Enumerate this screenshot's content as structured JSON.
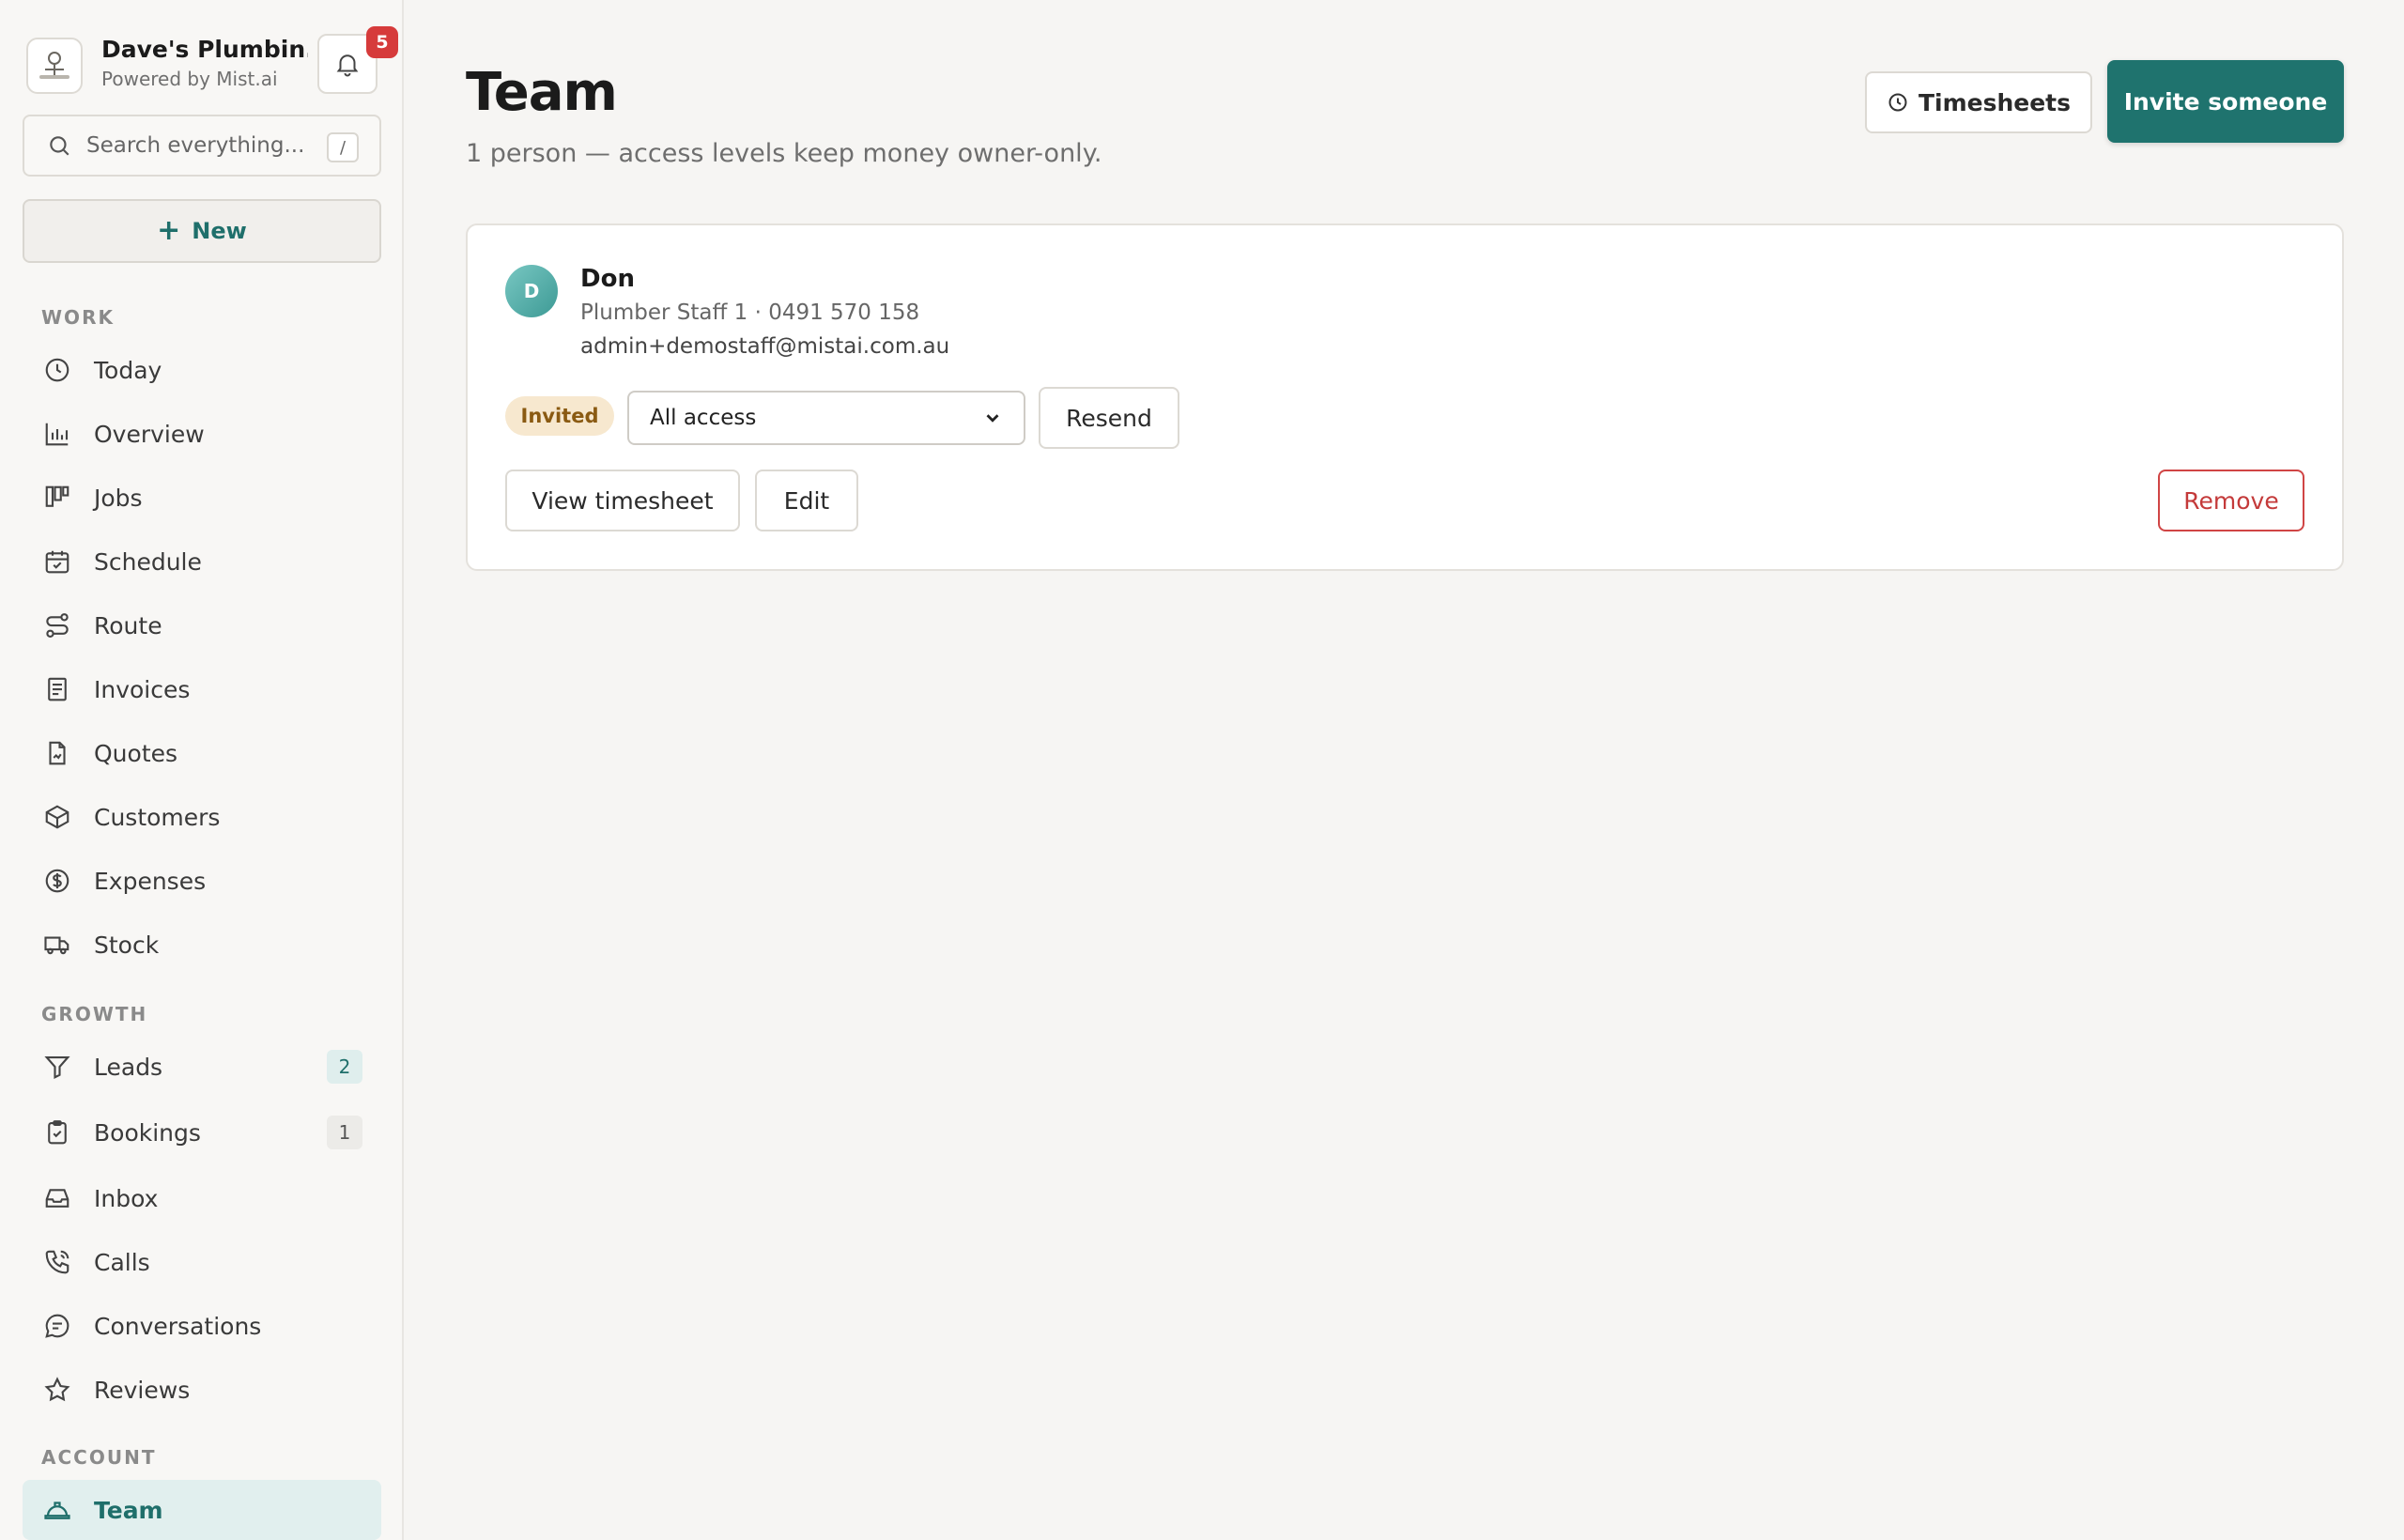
{
  "brand": {
    "name": "Dave's Plumbin...",
    "sub": "Powered by Mist.ai",
    "notifications": "5"
  },
  "search": {
    "placeholder": "Search everything...",
    "shortcut": "/"
  },
  "new_button": {
    "label": "New"
  },
  "sidebar": {
    "work_label": "WORK",
    "work": [
      {
        "label": "Today",
        "icon": "clock-icon"
      },
      {
        "label": "Overview",
        "icon": "bar-chart-icon"
      },
      {
        "label": "Jobs",
        "icon": "kanban-icon"
      },
      {
        "label": "Schedule",
        "icon": "calendar-check-icon"
      },
      {
        "label": "Route",
        "icon": "route-icon"
      },
      {
        "label": "Invoices",
        "icon": "receipt-icon"
      },
      {
        "label": "Quotes",
        "icon": "document-icon"
      },
      {
        "label": "Customers",
        "icon": "box-icon"
      },
      {
        "label": "Expenses",
        "icon": "dollar-circle-icon"
      },
      {
        "label": "Stock",
        "icon": "truck-icon"
      }
    ],
    "growth_label": "GROWTH",
    "growth": [
      {
        "label": "Leads",
        "icon": "funnel-icon",
        "count": "2"
      },
      {
        "label": "Bookings",
        "icon": "clipboard-check-icon",
        "count": "1"
      },
      {
        "label": "Inbox",
        "icon": "inbox-icon"
      },
      {
        "label": "Calls",
        "icon": "phone-icon"
      },
      {
        "label": "Conversations",
        "icon": "chat-icon"
      },
      {
        "label": "Reviews",
        "icon": "star-icon"
      }
    ],
    "account_label": "ACCOUNT",
    "account": [
      {
        "label": "Team",
        "icon": "hardhat-icon",
        "active": true
      }
    ]
  },
  "header": {
    "title": "Team",
    "subtitle": "1 person — access levels keep money owner-only.",
    "timesheets_label": "Timesheets",
    "invite_label": "Invite someone"
  },
  "member": {
    "initial": "D",
    "name": "Don",
    "meta": "Plumber Staff 1 · 0491 570 158",
    "email": "admin+demostaff@mistai.com.au",
    "status": "Invited",
    "access": "All access",
    "resend_label": "Resend",
    "view_timesheet_label": "View timesheet",
    "edit_label": "Edit",
    "remove_label": "Remove"
  },
  "colors": {
    "accent": "#1f736e",
    "danger": "#d04545",
    "invited_bg": "#f7e8cf"
  }
}
